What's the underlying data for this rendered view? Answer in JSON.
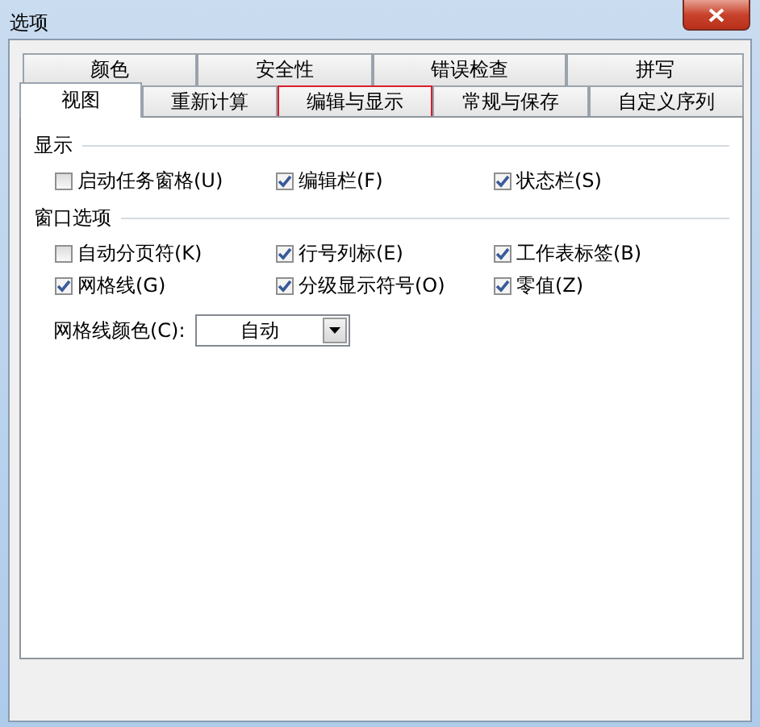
{
  "window": {
    "title": "选项"
  },
  "upper_tabs": [
    {
      "label": "颜色",
      "selected": false,
      "highlighted": false
    },
    {
      "label": "安全性",
      "selected": false,
      "highlighted": false
    },
    {
      "label": "错误检查",
      "selected": false,
      "highlighted": false
    },
    {
      "label": "拼写",
      "selected": false,
      "highlighted": false
    }
  ],
  "lower_tabs": [
    {
      "label": "视图",
      "selected": true,
      "highlighted": false
    },
    {
      "label": "重新计算",
      "selected": false,
      "highlighted": false
    },
    {
      "label": "编辑与显示",
      "selected": false,
      "highlighted": true
    },
    {
      "label": "常规与保存",
      "selected": false,
      "highlighted": false
    },
    {
      "label": "自定义序列",
      "selected": false,
      "highlighted": false
    }
  ],
  "sections": [
    {
      "title": "显示",
      "options": [
        {
          "label": "启动任务窗格(U)",
          "checked": false
        },
        {
          "label": "编辑栏(F)",
          "checked": true
        },
        {
          "label": "状态栏(S)",
          "checked": true
        }
      ]
    },
    {
      "title": "窗口选项",
      "options": [
        {
          "label": "自动分页符(K)",
          "checked": false
        },
        {
          "label": "行号列标(E)",
          "checked": true
        },
        {
          "label": "工作表标签(B)",
          "checked": true
        },
        {
          "label": "网格线(G)",
          "checked": true
        },
        {
          "label": "分级显示符号(O)",
          "checked": true
        },
        {
          "label": "零值(Z)",
          "checked": true
        }
      ]
    }
  ],
  "gridline_color": {
    "label": "网格线颜色(C):",
    "value": "自动"
  }
}
